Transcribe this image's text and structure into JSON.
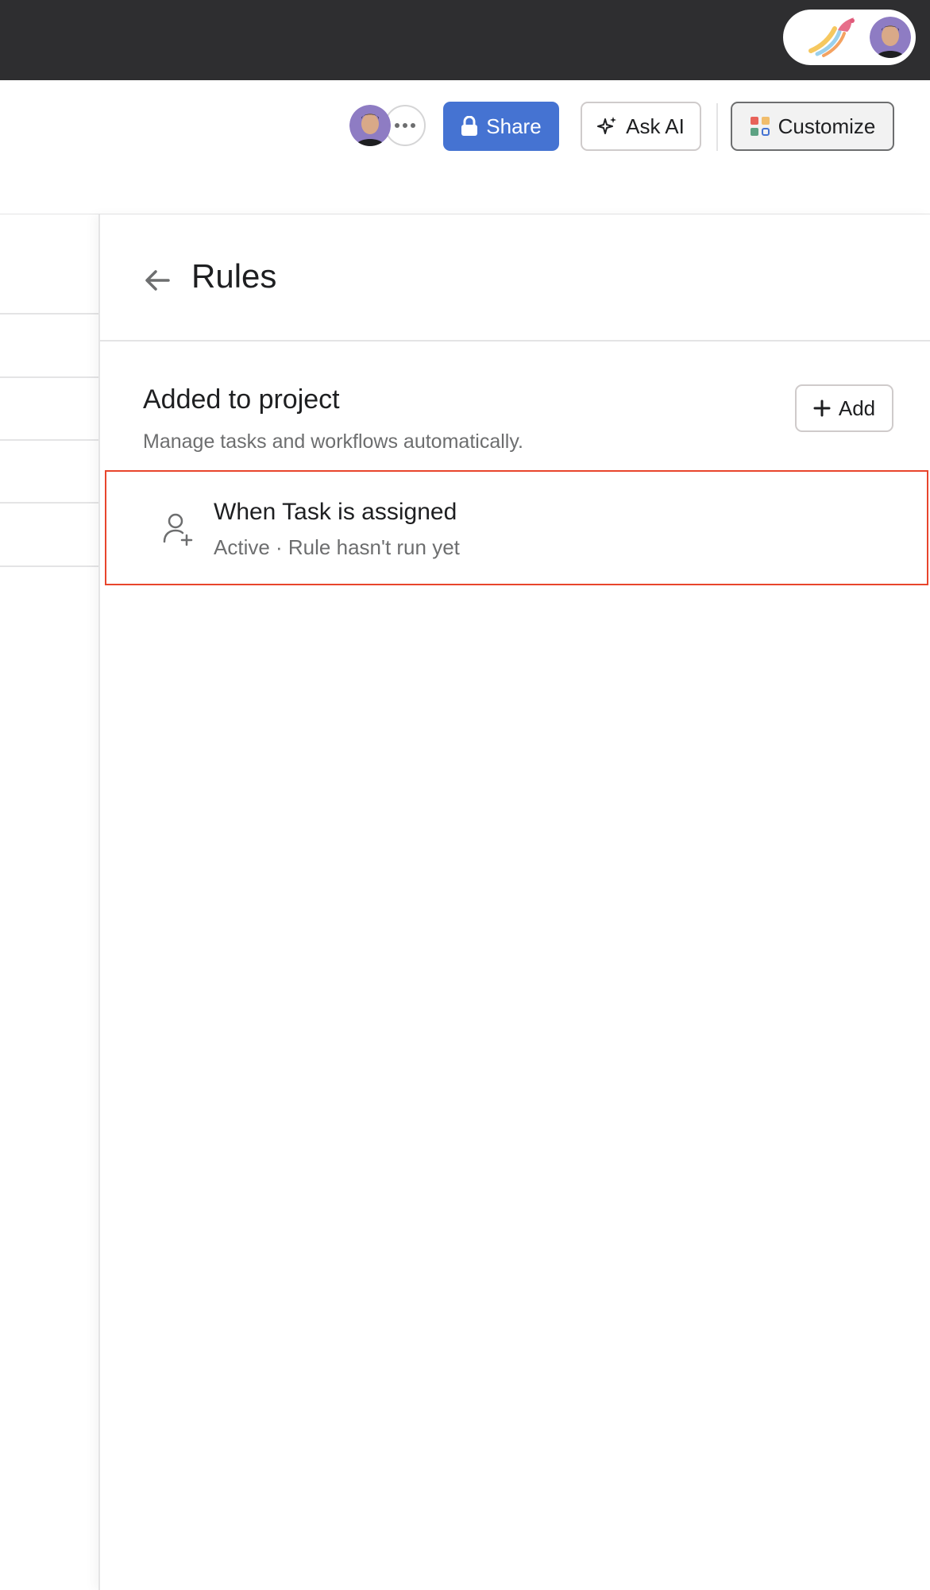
{
  "header": {
    "share_label": "Share",
    "ask_ai_label": "Ask AI",
    "customize_label": "Customize"
  },
  "panel": {
    "title": "Rules",
    "section_title": "Added to project",
    "section_subtitle": "Manage tasks and workflows automatically.",
    "add_label": "Add",
    "rules": [
      {
        "title": "When Task is assigned",
        "meta": "Active · Rule hasn't run yet"
      }
    ]
  },
  "colors": {
    "topbar": "#2e2e30",
    "share_button": "#4573d2",
    "highlight": "#e8452c",
    "avatar": "#8e7cc3"
  },
  "icons": [
    "app-logo-icon",
    "avatar",
    "more-icon",
    "lock-icon",
    "sparkle-icon",
    "customize-grid-icon",
    "back-arrow-icon",
    "plus-icon",
    "user-plus-icon"
  ]
}
